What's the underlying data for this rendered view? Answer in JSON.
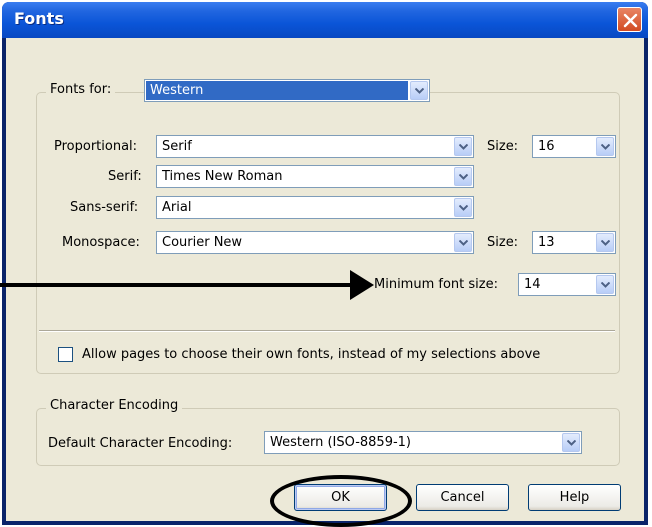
{
  "window": {
    "title": "Fonts"
  },
  "fonts_for": {
    "label": "Fonts for:",
    "value": "Western"
  },
  "proportional": {
    "label": "Proportional:",
    "value": "Serif",
    "size_label": "Size:",
    "size_value": "16"
  },
  "serif": {
    "label": "Serif:",
    "value": "Times New Roman"
  },
  "sans_serif": {
    "label": "Sans-serif:",
    "value": "Arial"
  },
  "monospace": {
    "label": "Monospace:",
    "value": "Courier New",
    "size_label": "Size:",
    "size_value": "13"
  },
  "minimum_font_size": {
    "label": "Minimum font size:",
    "value": "14"
  },
  "allow_pages": {
    "label": "Allow pages to choose their own fonts, instead of my selections above",
    "checked": false
  },
  "character_encoding": {
    "legend": "Character Encoding",
    "label": "Default Character Encoding:",
    "value": "Western (ISO-8859-1)"
  },
  "buttons": {
    "ok": "OK",
    "cancel": "Cancel",
    "help": "Help"
  },
  "colors": {
    "titlebar": "#0a55d8",
    "dialog_bg": "#ece9d8",
    "selection": "#316ac5",
    "close": "#d24b22"
  },
  "icons": {
    "close": "close-x-icon",
    "dropdown": "chevron-down-icon"
  }
}
